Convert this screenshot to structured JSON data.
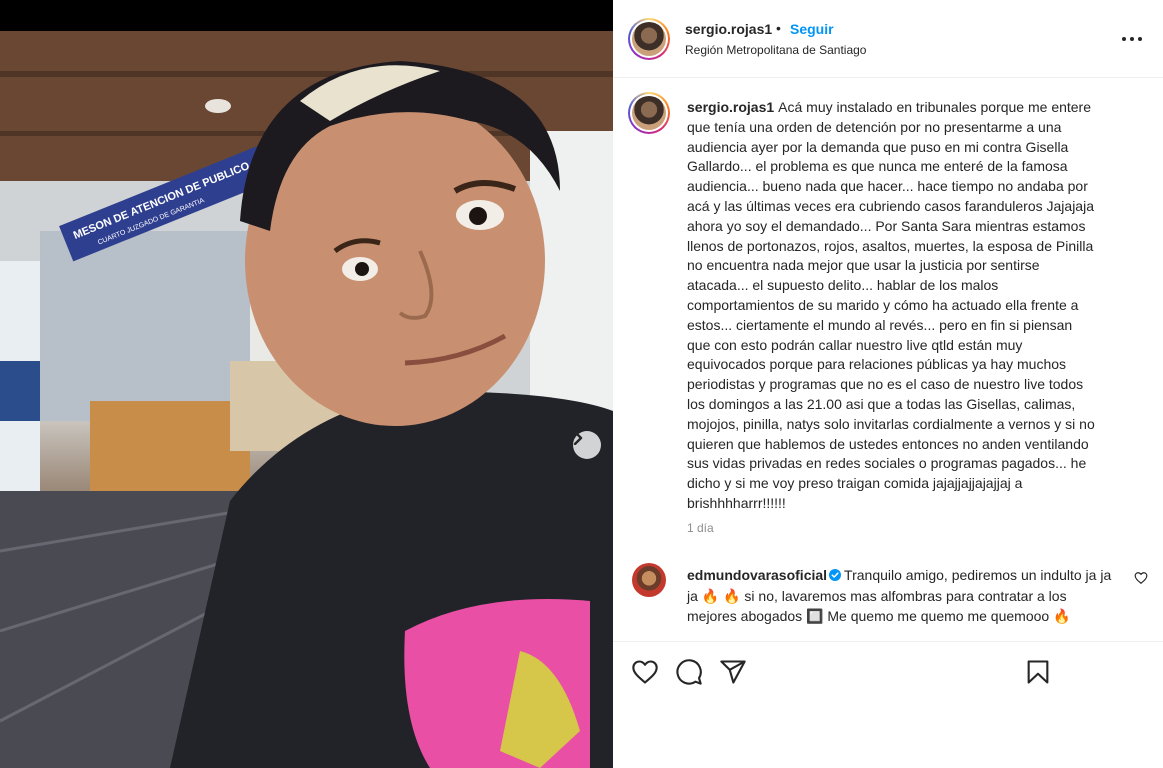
{
  "post": {
    "username": "sergio.rojas1",
    "separator": "•",
    "follow_label": "Seguir",
    "location": "Región Metropolitana de Santiago",
    "caption": "Acá muy instalado en tribunales porque me entere que tenía una orden de detención por no presentarme a una audiencia ayer por la demanda que puso en mi contra Gisella Gallardo... el problema es que nunca me enteré de la famosa audiencia... bueno nada que hacer... hace tiempo no andaba por acá y las últimas veces era cubriendo casos faranduleros Jajajaja ahora yo soy el demandado... Por Santa Sara mientras estamos llenos de portonazos, rojos, asaltos, muertes, la esposa de Pinilla no encuentra nada mejor que usar la justicia por sentirse atacada... el supuesto delito... hablar de los malos comportamientos de su marido y cómo ha actuado ella frente a estos... ciertamente el mundo al revés... pero en fin si piensan que con esto podrán callar nuestro live qtld están muy equivocados porque para relaciones públicas ya hay muchos periodistas y programas que no es el caso de nuestro live todos los domingos a las 21.00 asi que a todas las Gisellas, calimas, mojojos, pinilla, natys solo invitarlas cordialmente a vernos y si no quieren que hablemos de ustedes entonces no anden ventilando sus vidas privadas en redes sociales o programas pagados... he dicho y si me voy preso traigan comida jajajjajjajajjaj a brishhhharrr!!!!!!",
    "time_ago": "1 día"
  },
  "comment": {
    "username": "edmundovarasoficial",
    "text": "Tranquilo amigo, pediremos un indulto ja ja ja 🔥 🔥 si no, lavaremos mas alfombras para contratar a los mejores abogados 🔲 Me quemo me quemo me quemooo 🔥"
  },
  "media": {
    "sign_text": "MESON DE ATENCION DE PUBLICO",
    "sign_subtext": "CUARTO JUZGADO DE GARANTIA"
  },
  "icons": {
    "next": "chevron-right-icon",
    "more": "more-options-icon",
    "like": "heart-icon",
    "comment": "comment-icon",
    "share": "share-icon",
    "save": "bookmark-icon",
    "verified": "verified-badge-icon"
  },
  "colors": {
    "link_blue": "#0095f6",
    "verified_blue": "#0095f6",
    "text": "#262626",
    "secondary": "#8e8e8e",
    "border": "#efefef"
  }
}
